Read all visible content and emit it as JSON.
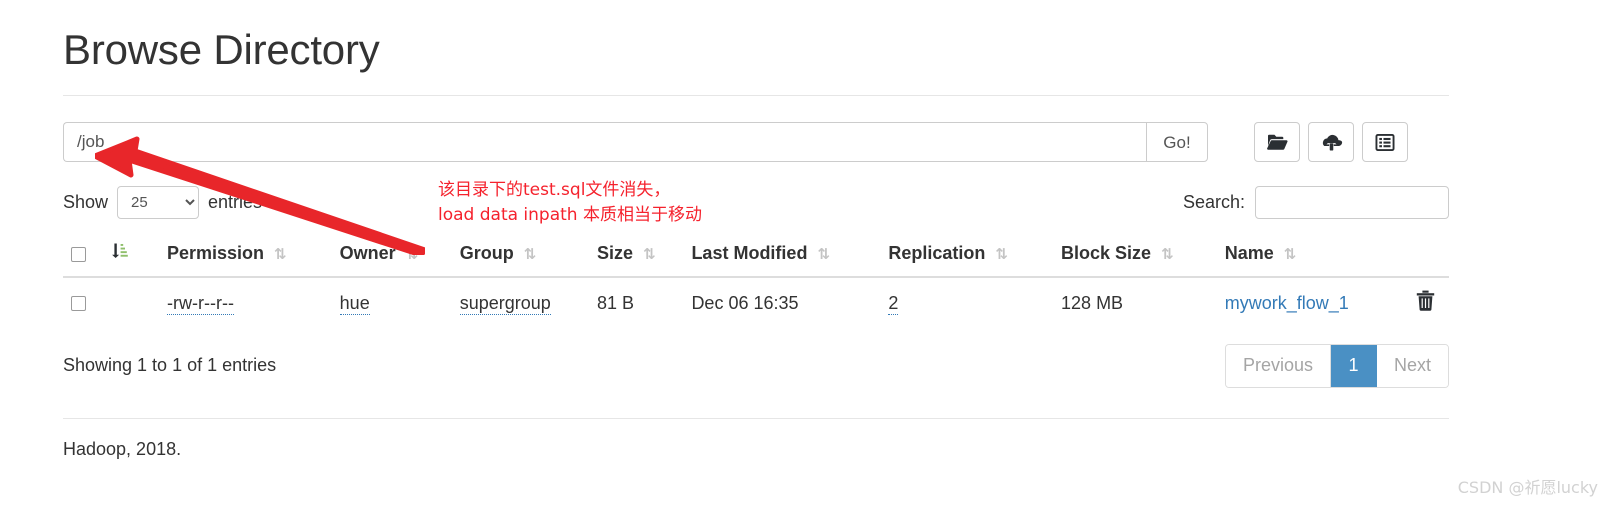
{
  "page": {
    "title": "Browse Directory",
    "footer_text": "Hadoop, 2018."
  },
  "path_bar": {
    "value": "/job",
    "placeholder": "",
    "go_label": "Go!",
    "buttons": [
      {
        "name": "create-directory-button",
        "icon": "folder-open-icon"
      },
      {
        "name": "upload-file-button",
        "icon": "cloud-upload-icon"
      },
      {
        "name": "cut-high-availability-button",
        "icon": "list-alt-icon"
      }
    ]
  },
  "controls": {
    "show_label": "Show",
    "entries_label": "entries",
    "page_length": "25",
    "page_length_options": [
      "25"
    ],
    "search_label": "Search:",
    "search_value": "",
    "search_placeholder": ""
  },
  "annotation": {
    "text": "该目录下的test.sql文件消失，\nload data inpath 本质相当于移动",
    "color": "#f5222d"
  },
  "table": {
    "columns": [
      {
        "label": "",
        "sort": "sort-amount-down-icon"
      },
      {
        "label": "Permission",
        "sort": "sort-icon"
      },
      {
        "label": "Owner",
        "sort": "sort-icon"
      },
      {
        "label": "Group",
        "sort": "sort-icon"
      },
      {
        "label": "Size",
        "sort": "sort-icon"
      },
      {
        "label": "Last Modified",
        "sort": "sort-icon"
      },
      {
        "label": "Replication",
        "sort": "sort-icon"
      },
      {
        "label": "Block Size",
        "sort": "sort-icon"
      },
      {
        "label": "Name",
        "sort": "sort-icon"
      }
    ],
    "rows": [
      {
        "permission": "-rw-r--r--",
        "owner": "hue",
        "group": "supergroup",
        "size": "81 B",
        "last_modified": "Dec 06 16:35",
        "replication": "2",
        "block_size": "128 MB",
        "name": "mywork_flow_1",
        "delete_icon": "trash-icon"
      }
    ]
  },
  "table_footer": {
    "info": "Showing 1 to 1 of 1 entries",
    "previous_label": "Previous",
    "current_page": "1",
    "next_label": "Next"
  },
  "watermark": "CSDN @祈愿lucky",
  "colors": {
    "link": "#337ab7",
    "active_page": "#4a90c4",
    "annotation": "#f5222d",
    "arrow": "#e8262a"
  }
}
